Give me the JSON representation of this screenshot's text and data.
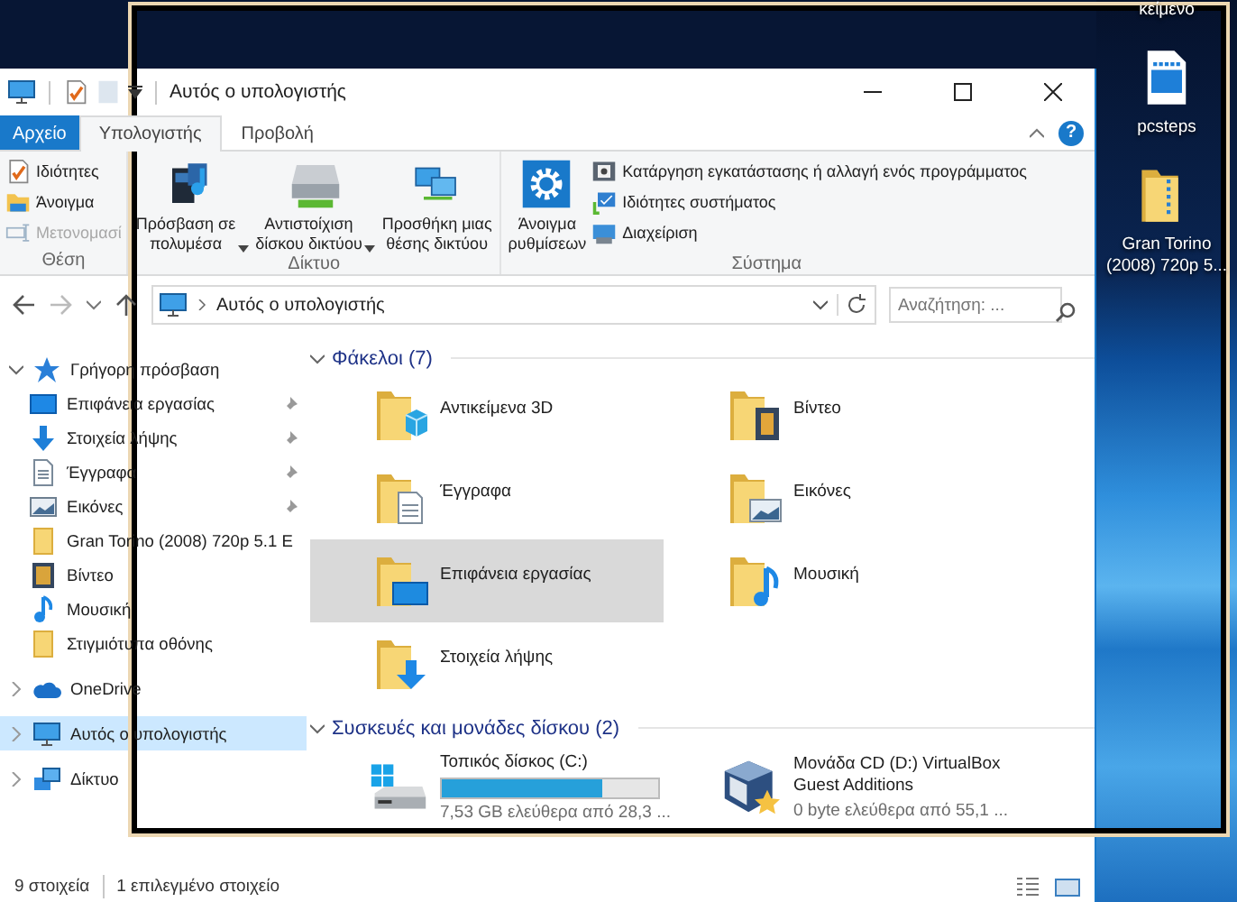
{
  "desktop": {
    "icons": [
      {
        "label": "κείμενο",
        "kind": "cut"
      },
      {
        "label": "pcsteps",
        "kind": "video"
      },
      {
        "label": "Gran Torino (2008) 720p 5...",
        "kind": "zip"
      }
    ]
  },
  "window": {
    "title": "Αυτός ο υπολογιστής",
    "help": "?"
  },
  "ribbon": {
    "tabs": [
      {
        "label": "Αρχείο",
        "kind": "file",
        "selected": false
      },
      {
        "label": "Υπολογιστής",
        "kind": "tab",
        "selected": true
      },
      {
        "label": "Προβολή",
        "kind": "tab",
        "selected": false
      }
    ],
    "groups": [
      {
        "label": "Θέση",
        "items": [
          {
            "label": "Ιδιότητες",
            "kind": "small",
            "disabled": false
          },
          {
            "label": "Άνοιγμα",
            "kind": "small",
            "disabled": false
          },
          {
            "label": "Μετονομασί",
            "kind": "small",
            "disabled": true
          }
        ]
      },
      {
        "label": "Δίκτυο",
        "items": [
          {
            "label": "Πρόσβαση σε\nπολυμέσα",
            "kind": "big",
            "dropdown": true
          },
          {
            "label": "Αντιστοίχιση\nδίσκου δικτύου",
            "kind": "big",
            "dropdown": true
          },
          {
            "label": "Προσθήκη μιας\nθέσης δικτύου",
            "kind": "big",
            "dropdown": false
          }
        ]
      },
      {
        "label": "Σύστημα",
        "items": [
          {
            "label": "Άνοιγμα\nρυθμίσεων",
            "kind": "big",
            "dropdown": false
          },
          {
            "label": "Κατάργηση εγκατάστασης ή αλλαγή ενός προγράμματος",
            "kind": "small",
            "disabled": false
          },
          {
            "label": "Ιδιότητες συστήματος",
            "kind": "small",
            "disabled": false
          },
          {
            "label": "Διαχείριση",
            "kind": "small",
            "disabled": false
          }
        ]
      }
    ]
  },
  "address": {
    "path": "Αυτός ο υπολογιστής"
  },
  "search": {
    "placeholder": "Αναζήτηση: ..."
  },
  "nav": {
    "items": [
      {
        "label": "Γρήγορη πρόσβαση",
        "kind": "quick",
        "expanded": true,
        "selected": false,
        "children": [
          {
            "label": "Επιφάνεια εργασίας",
            "kind": "desktop",
            "pinned": true
          },
          {
            "label": "Στοιχεία λήψης",
            "kind": "downloads",
            "pinned": true
          },
          {
            "label": "Έγγραφα",
            "kind": "documents",
            "pinned": true
          },
          {
            "label": "Εικόνες",
            "kind": "pictures",
            "pinned": true
          },
          {
            "label": "Gran Torino (2008) 720p 5.1 E",
            "kind": "folder",
            "pinned": false
          },
          {
            "label": "Βίντεο",
            "kind": "video",
            "pinned": false
          },
          {
            "label": "Μουσική",
            "kind": "music",
            "pinned": false
          },
          {
            "label": "Στιγμιότυπα οθόνης",
            "kind": "folder",
            "pinned": false
          }
        ]
      },
      {
        "label": "OneDrive",
        "kind": "onedrive",
        "expanded": false,
        "selected": false
      },
      {
        "label": "Αυτός ο υπολογιστής",
        "kind": "pc",
        "expanded": false,
        "selected": true
      },
      {
        "label": "Δίκτυο",
        "kind": "network",
        "expanded": false,
        "selected": false
      }
    ]
  },
  "content": {
    "sections": [
      {
        "title": "Φάκελοι (7)",
        "expanded": true,
        "folders": [
          {
            "label": "Αντικείμενα 3D",
            "kind": "objects",
            "selected": false
          },
          {
            "label": "Βίντεο",
            "kind": "video",
            "selected": false
          },
          {
            "label": "Έγγραφα",
            "kind": "documents",
            "selected": false
          },
          {
            "label": "Εικόνες",
            "kind": "pictures",
            "selected": false
          },
          {
            "label": "Επιφάνεια εργασίας",
            "kind": "desktop",
            "selected": true
          },
          {
            "label": "Μουσική",
            "kind": "music",
            "selected": false
          },
          {
            "label": "Στοιχεία λήψης",
            "kind": "downloads",
            "selected": false
          }
        ]
      },
      {
        "title": "Συσκευές και μονάδες δίσκου (2)",
        "expanded": true,
        "drives": [
          {
            "name": "Τοπικός δίσκος (C:)",
            "kind": "disk",
            "level": 0.74,
            "free": "7,53 GB ελεύθερα από 28,3 ..."
          },
          {
            "name": "Μονάδα CD (D:) VirtualBox Guest Additions",
            "kind": "cd",
            "free": "0 byte ελεύθερα από 55,1 ..."
          }
        ]
      }
    ]
  },
  "status_bar": {
    "count": "9 στοιχεία",
    "selection": "1 επιλεγμένο στοιχείο"
  }
}
